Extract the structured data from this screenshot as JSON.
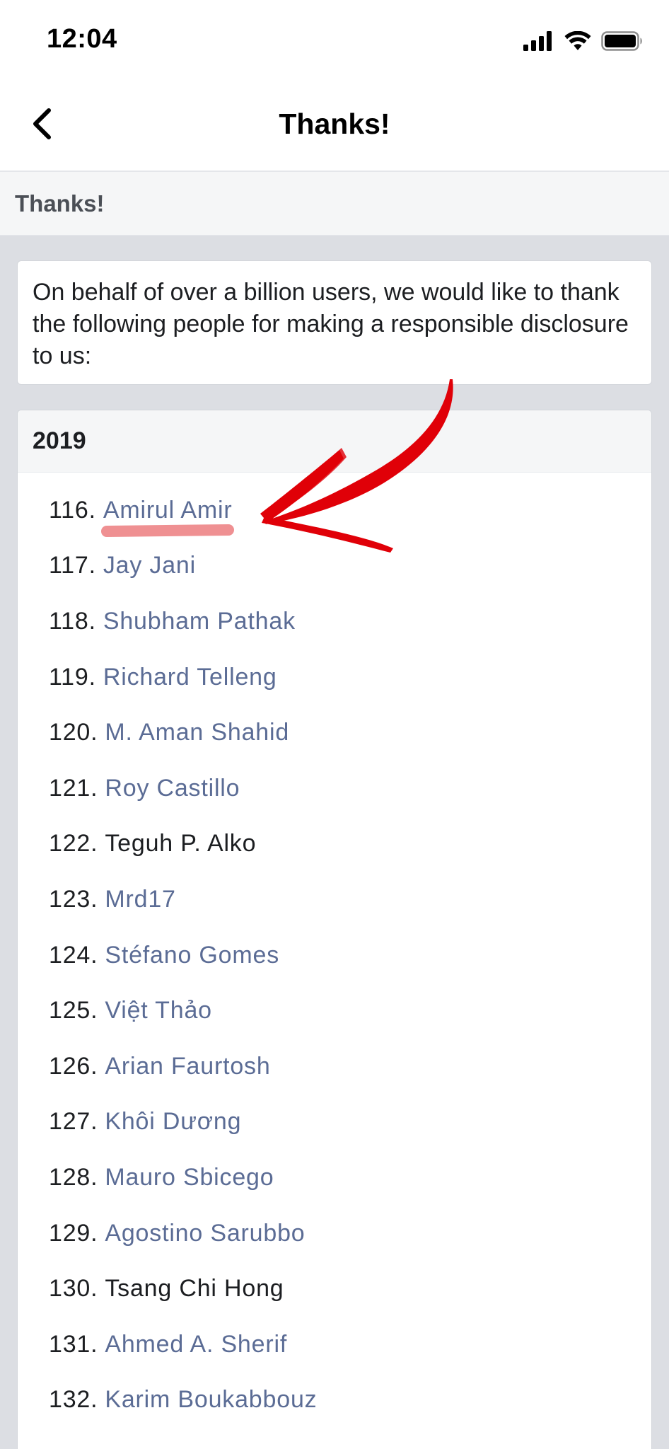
{
  "status_bar": {
    "time": "12:04",
    "icons": [
      "cellular-signal-icon",
      "wifi-icon",
      "battery-icon"
    ]
  },
  "nav": {
    "back_icon": "chevron-left-icon",
    "title": "Thanks!"
  },
  "section": {
    "title": "Thanks!"
  },
  "intro": {
    "text": "On behalf of over a billion users, we would like to thank the following people for making a responsible disclosure to us:"
  },
  "year_block": {
    "year": "2019",
    "items": [
      {
        "number": "116.",
        "name": "Amirul Amir",
        "linked": true
      },
      {
        "number": "117.",
        "name": "Jay Jani",
        "linked": true
      },
      {
        "number": "118.",
        "name": "Shubham Pathak",
        "linked": true
      },
      {
        "number": "119.",
        "name": "Richard Telleng",
        "linked": true
      },
      {
        "number": "120.",
        "name": "M. Aman Shahid",
        "linked": true
      },
      {
        "number": "121.",
        "name": "Roy Castillo",
        "linked": true
      },
      {
        "number": "122.",
        "name": "Teguh P. Alko",
        "linked": false
      },
      {
        "number": "123.",
        "name": "Mrd17",
        "linked": true
      },
      {
        "number": "124.",
        "name": "Stéfano Gomes",
        "linked": true
      },
      {
        "number": "125.",
        "name": "Việt Thảo",
        "linked": true
      },
      {
        "number": "126.",
        "name": "Arian Faurtosh",
        "linked": true
      },
      {
        "number": "127.",
        "name": "Khôi Dương",
        "linked": true
      },
      {
        "number": "128.",
        "name": "Mauro Sbicego",
        "linked": true
      },
      {
        "number": "129.",
        "name": "Agostino Sarubbo",
        "linked": true
      },
      {
        "number": "130.",
        "name": "Tsang Chi Hong",
        "linked": false
      },
      {
        "number": "131.",
        "name": "Ahmed A. Sherif",
        "linked": true
      },
      {
        "number": "132.",
        "name": "Karim Boukabbouz",
        "linked": true
      }
    ]
  },
  "annotation": {
    "arrow_color": "#e00008",
    "underline_color": "#ee8a8c",
    "highlighted_item": "Amirul Amir"
  },
  "colors": {
    "link": "#5b6c95",
    "text": "#1c1e21",
    "page_background": "#dcdee3"
  }
}
